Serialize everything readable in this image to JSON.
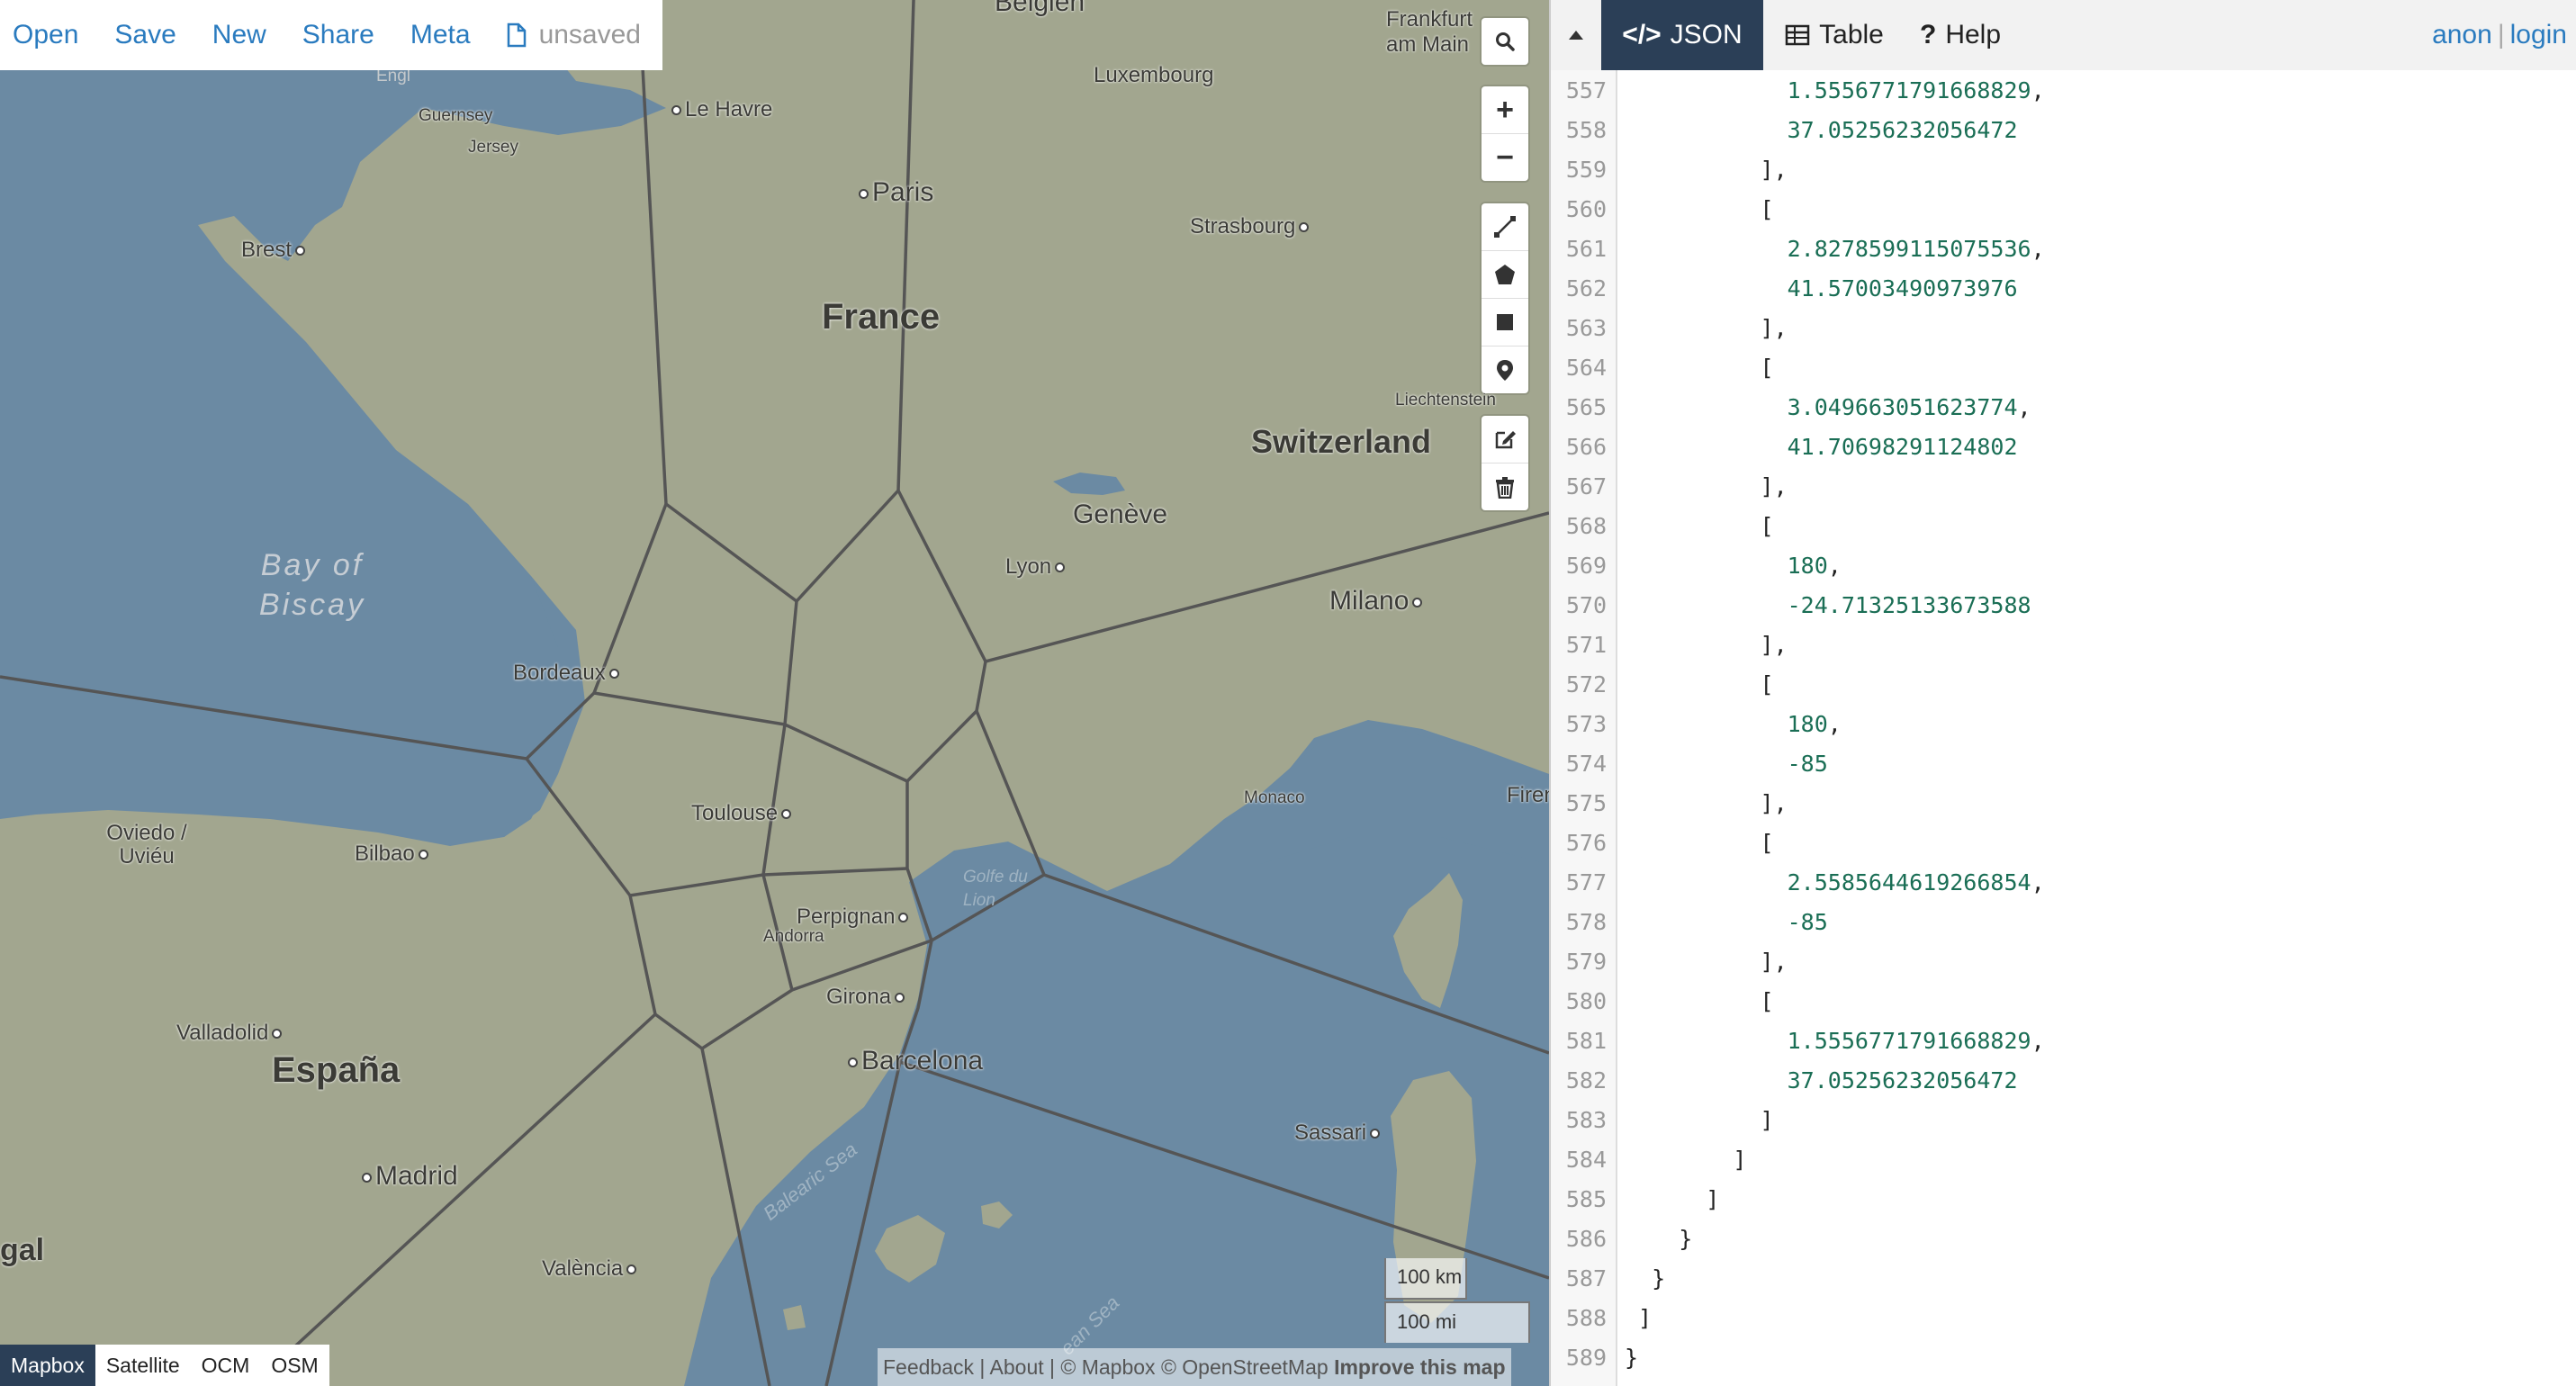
{
  "toolbar": {
    "open": "Open",
    "save": "Save",
    "new": "New",
    "share": "Share",
    "meta": "Meta",
    "status": "unsaved"
  },
  "map": {
    "labels": {
      "belgien": "Belgien",
      "frankfurt": "Frankfurt am Main",
      "luxembourg": "Luxembourg",
      "guernsey": "Guernsey",
      "jersey": "Jersey",
      "le_havre": "Le Havre",
      "paris": "Paris",
      "brest": "Brest",
      "strasbourg": "Strasbourg",
      "france": "France",
      "liechtenstein": "Liechtenstein",
      "switzerland": "Switzerland",
      "geneve": "Genève",
      "lyon": "Lyon",
      "bay_of_biscay": "Bay of Biscay",
      "milano": "Milano",
      "bordeaux": "Bordeaux",
      "monaco": "Monaco",
      "firenze": "Firen",
      "toulouse": "Toulouse",
      "oviedo": "Oviedo / Uviéu",
      "bilbao": "Bilbao",
      "golfe": "Golfe du Lion",
      "perpignan": "Perpignan",
      "andorra": "Andorra",
      "girona": "Girona",
      "valladolid": "Valladolid",
      "espana": "España",
      "barcelona": "Barcelona",
      "sassari": "Sassari",
      "madrid": "Madrid",
      "balearic": "Balearic Sea",
      "valencia": "València",
      "portugal": "gal",
      "tyrrhenian": "ean Sea",
      "engl": "Engl"
    },
    "scale": {
      "km": "100 km",
      "mi": "100 mi"
    },
    "layers": [
      "Mapbox",
      "Satellite",
      "OCM",
      "OSM"
    ],
    "active_layer": "Mapbox",
    "attribution": {
      "feedback": "Feedback",
      "about": "About",
      "mapbox": "© Mapbox",
      "osm": "© OpenStreetMap",
      "improve": "Improve this map"
    },
    "controls": [
      "search-icon",
      "zoom-in",
      "zoom-out",
      "draw-line-icon",
      "draw-polygon-icon",
      "draw-rectangle-icon",
      "draw-marker-icon",
      "edit-icon",
      "trash-icon"
    ]
  },
  "pane": {
    "tabs": {
      "json": "JSON",
      "table": "Table",
      "help": "Help"
    },
    "active_tab": "JSON",
    "user": {
      "anon": "anon",
      "login": "login"
    }
  },
  "code_lines": [
    {
      "n": "557",
      "t": "            1.5556771791668829,"
    },
    {
      "n": "558",
      "t": "            37.05256232056472"
    },
    {
      "n": "559",
      "t": "          ],"
    },
    {
      "n": "560",
      "t": "          ["
    },
    {
      "n": "561",
      "t": "            2.8278599115075536,"
    },
    {
      "n": "562",
      "t": "            41.57003490973976"
    },
    {
      "n": "563",
      "t": "          ],"
    },
    {
      "n": "564",
      "t": "          ["
    },
    {
      "n": "565",
      "t": "            3.049663051623774,"
    },
    {
      "n": "566",
      "t": "            41.70698291124802"
    },
    {
      "n": "567",
      "t": "          ],"
    },
    {
      "n": "568",
      "t": "          ["
    },
    {
      "n": "569",
      "t": "            180,"
    },
    {
      "n": "570",
      "t": "            -24.71325133673588"
    },
    {
      "n": "571",
      "t": "          ],"
    },
    {
      "n": "572",
      "t": "          ["
    },
    {
      "n": "573",
      "t": "            180,"
    },
    {
      "n": "574",
      "t": "            -85"
    },
    {
      "n": "575",
      "t": "          ],"
    },
    {
      "n": "576",
      "t": "          ["
    },
    {
      "n": "577",
      "t": "            2.5585644619266854,"
    },
    {
      "n": "578",
      "t": "            -85"
    },
    {
      "n": "579",
      "t": "          ],"
    },
    {
      "n": "580",
      "t": "          ["
    },
    {
      "n": "581",
      "t": "            1.5556771791668829,"
    },
    {
      "n": "582",
      "t": "            37.05256232056472"
    },
    {
      "n": "583",
      "t": "          ]"
    },
    {
      "n": "584",
      "t": "        ]"
    },
    {
      "n": "585",
      "t": "      ]"
    },
    {
      "n": "586",
      "t": "    }"
    },
    {
      "n": "587",
      "t": "  }"
    },
    {
      "n": "588",
      "t": " ]"
    },
    {
      "n": "589",
      "t": "}"
    }
  ],
  "colors": {
    "sea": "#6b8aa3",
    "land": "#a3a78f",
    "voronoi": "#555555",
    "link": "#2a7bbf",
    "active_tab": "#2b3f57",
    "number": "#1a6e55"
  }
}
